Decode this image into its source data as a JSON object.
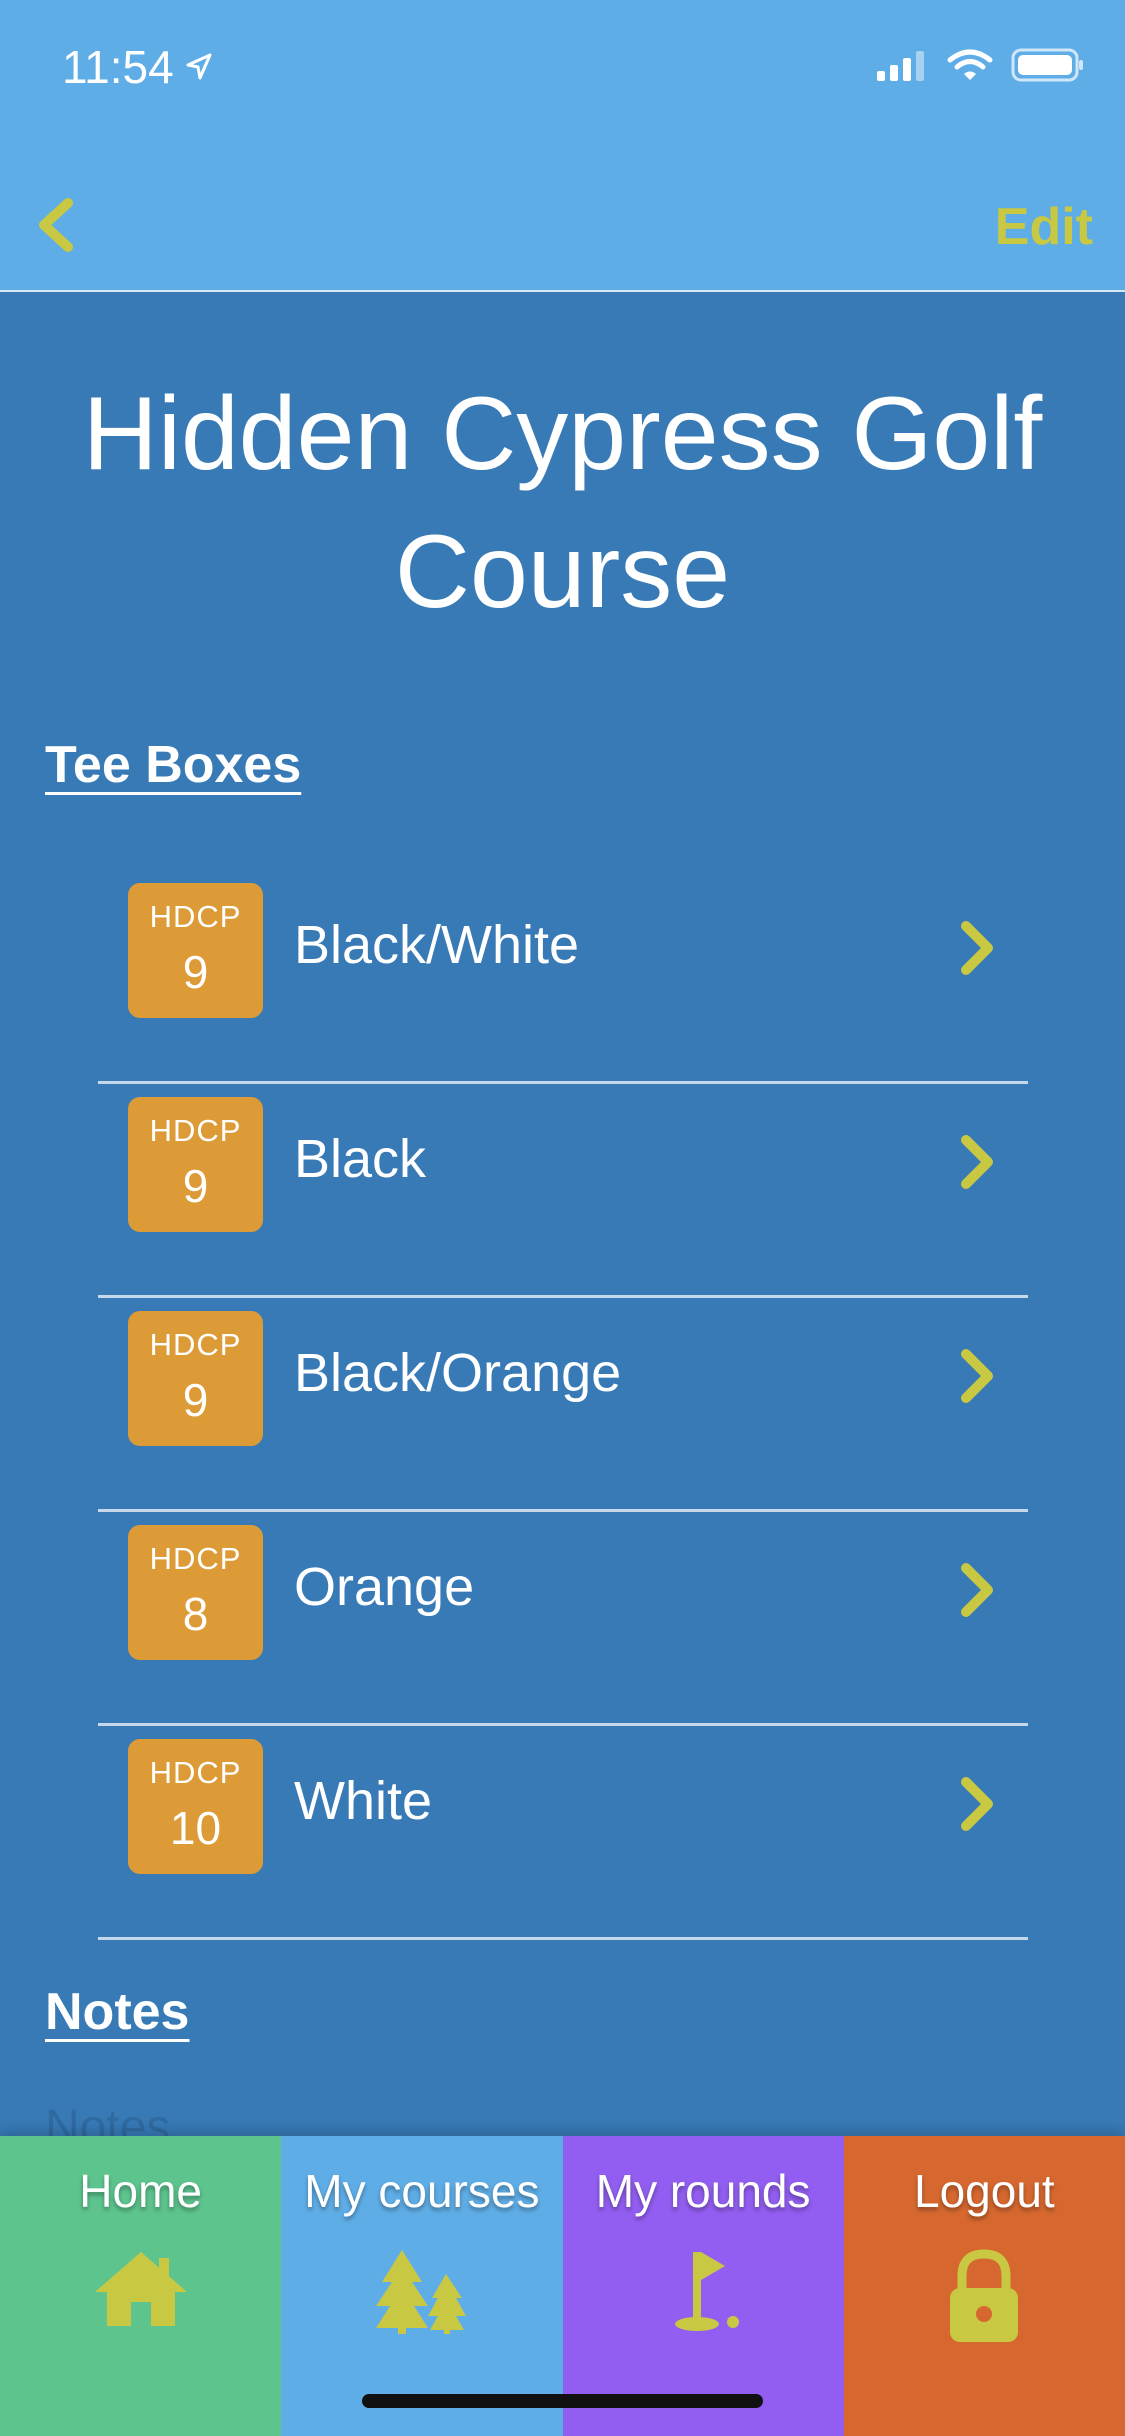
{
  "status_bar": {
    "time": "11:54"
  },
  "nav": {
    "edit_label": "Edit"
  },
  "course": {
    "title": "Hidden Cypress Golf Course"
  },
  "tee_boxes": {
    "heading": "Tee Boxes",
    "items": [
      {
        "hdcp_label": "HDCP",
        "hdcp": "9",
        "name": "Black/White"
      },
      {
        "hdcp_label": "HDCP",
        "hdcp": "9",
        "name": "Black"
      },
      {
        "hdcp_label": "HDCP",
        "hdcp": "9",
        "name": "Black/Orange"
      },
      {
        "hdcp_label": "HDCP",
        "hdcp": "8",
        "name": "Orange"
      },
      {
        "hdcp_label": "HDCP",
        "hdcp": "10",
        "name": "White"
      }
    ]
  },
  "notes": {
    "heading": "Notes",
    "placeholder": "Notes"
  },
  "tabs": [
    {
      "label": "Home",
      "icon": "home-icon",
      "color": "#5dc48e"
    },
    {
      "label": "My courses",
      "icon": "trees-icon",
      "color": "#5fade6"
    },
    {
      "label": "My rounds",
      "icon": "golf-flag-icon",
      "color": "#925ef1"
    },
    {
      "label": "Logout",
      "icon": "lock-icon",
      "color": "#d6682f"
    }
  ],
  "colors": {
    "background": "#377ab6",
    "header": "#5fade6",
    "accent": "#c9c843",
    "hdcp_badge": "#dd9b38"
  }
}
